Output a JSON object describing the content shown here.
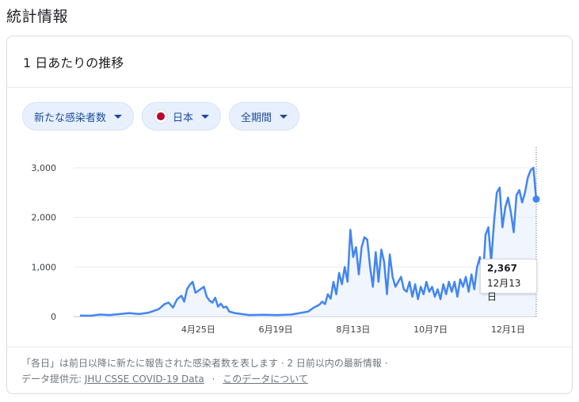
{
  "page": {
    "title": "統計情報"
  },
  "card": {
    "title": "1 日あたりの推移"
  },
  "filters": {
    "metric": "新たな感染者数",
    "region": "日本",
    "period": "全期間"
  },
  "tooltip": {
    "value": "2,367",
    "date": "12月13日"
  },
  "footer": {
    "note": "「各日」は前日以降に新たに報告された感染者数を表します · 2 日前以内の最新情報 ·",
    "source_prefix": "データ提供元:",
    "source_link": "JHU CSSE COVID-19 Data",
    "separator": "·",
    "about_link": "このデータについて"
  },
  "colors": {
    "line": "#4285f4",
    "area": "#e8f0fe",
    "chip_bg": "#e8f0fe",
    "chip_text": "#1a4c9c"
  },
  "chart_data": {
    "type": "line",
    "title": "",
    "xlabel": "",
    "ylabel": "",
    "ylim": [
      0,
      3000
    ],
    "yticks": [
      0,
      1000,
      2000,
      3000
    ],
    "ytick_labels": [
      "0",
      "1,000",
      "2,000",
      "3,000"
    ],
    "xticks": [
      {
        "label": "4月25日",
        "day": 84
      },
      {
        "label": "6月19日",
        "day": 139
      },
      {
        "label": "8月13日",
        "day": 194
      },
      {
        "label": "10月7日",
        "day": 249
      },
      {
        "label": "12月1日",
        "day": 304
      }
    ],
    "series": [
      {
        "points": [
          [
            0,
            20
          ],
          [
            7,
            15
          ],
          [
            14,
            40
          ],
          [
            21,
            30
          ],
          [
            28,
            50
          ],
          [
            35,
            70
          ],
          [
            42,
            50
          ],
          [
            49,
            80
          ],
          [
            56,
            150
          ],
          [
            60,
            250
          ],
          [
            63,
            280
          ],
          [
            66,
            180
          ],
          [
            69,
            350
          ],
          [
            72,
            420
          ],
          [
            74,
            300
          ],
          [
            76,
            550
          ],
          [
            78,
            640
          ],
          [
            80,
            700
          ],
          [
            82,
            480
          ],
          [
            84,
            520
          ],
          [
            86,
            560
          ],
          [
            88,
            600
          ],
          [
            90,
            400
          ],
          [
            92,
            320
          ],
          [
            94,
            280
          ],
          [
            96,
            380
          ],
          [
            98,
            200
          ],
          [
            100,
            260
          ],
          [
            102,
            180
          ],
          [
            104,
            200
          ],
          [
            106,
            100
          ],
          [
            110,
            70
          ],
          [
            115,
            50
          ],
          [
            120,
            30
          ],
          [
            130,
            35
          ],
          [
            140,
            30
          ],
          [
            150,
            40
          ],
          [
            158,
            80
          ],
          [
            162,
            100
          ],
          [
            166,
            180
          ],
          [
            170,
            240
          ],
          [
            172,
            300
          ],
          [
            174,
            250
          ],
          [
            176,
            450
          ],
          [
            178,
            360
          ],
          [
            180,
            700
          ],
          [
            182,
            450
          ],
          [
            184,
            880
          ],
          [
            186,
            650
          ],
          [
            188,
            1000
          ],
          [
            190,
            700
          ],
          [
            192,
            1750
          ],
          [
            194,
            1200
          ],
          [
            196,
            1400
          ],
          [
            198,
            850
          ],
          [
            200,
            1400
          ],
          [
            202,
            1600
          ],
          [
            204,
            1550
          ],
          [
            206,
            1000
          ],
          [
            208,
            600
          ],
          [
            210,
            1300
          ],
          [
            212,
            700
          ],
          [
            214,
            1350
          ],
          [
            216,
            1100
          ],
          [
            218,
            450
          ],
          [
            220,
            1250
          ],
          [
            222,
            800
          ],
          [
            224,
            600
          ],
          [
            226,
            700
          ],
          [
            228,
            800
          ],
          [
            230,
            550
          ],
          [
            232,
            500
          ],
          [
            234,
            700
          ],
          [
            236,
            400
          ],
          [
            238,
            650
          ],
          [
            240,
            350
          ],
          [
            242,
            600
          ],
          [
            244,
            450
          ],
          [
            246,
            700
          ],
          [
            248,
            500
          ],
          [
            250,
            600
          ],
          [
            252,
            400
          ],
          [
            254,
            550
          ],
          [
            256,
            350
          ],
          [
            258,
            650
          ],
          [
            260,
            450
          ],
          [
            262,
            700
          ],
          [
            264,
            500
          ],
          [
            266,
            700
          ],
          [
            268,
            400
          ],
          [
            270,
            750
          ],
          [
            272,
            600
          ],
          [
            274,
            800
          ],
          [
            276,
            500
          ],
          [
            278,
            850
          ],
          [
            280,
            550
          ],
          [
            282,
            1000
          ],
          [
            284,
            1200
          ],
          [
            286,
            700
          ],
          [
            288,
            1650
          ],
          [
            290,
            1800
          ],
          [
            292,
            1100
          ],
          [
            294,
            1900
          ],
          [
            296,
            2500
          ],
          [
            298,
            2600
          ],
          [
            300,
            1800
          ],
          [
            302,
            2200
          ],
          [
            304,
            2400
          ],
          [
            306,
            2100
          ],
          [
            308,
            1700
          ],
          [
            310,
            2450
          ],
          [
            312,
            2550
          ],
          [
            314,
            2300
          ],
          [
            316,
            2500
          ],
          [
            318,
            2800
          ],
          [
            320,
            2950
          ],
          [
            322,
            3000
          ],
          [
            324,
            2367
          ]
        ]
      }
    ],
    "highlight": {
      "day": 324,
      "value": 2367,
      "label": "2,367",
      "date": "12月13日"
    },
    "grid": true
  }
}
